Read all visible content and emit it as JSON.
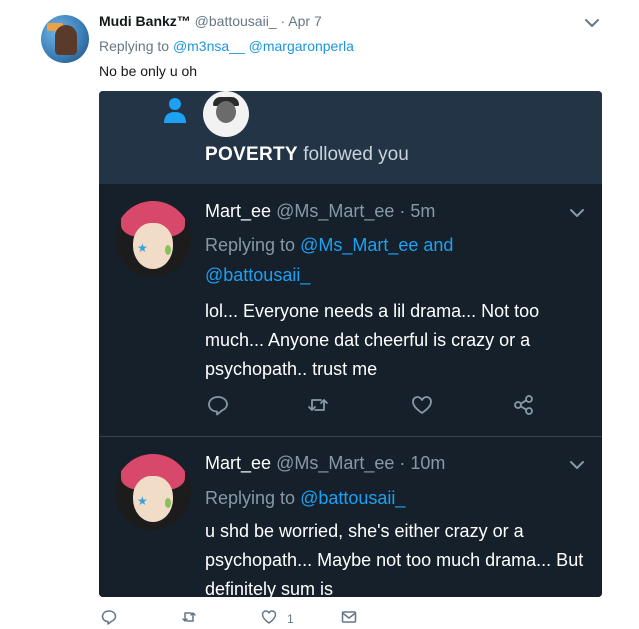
{
  "tweet": {
    "author_name": "Mudi Bankz™",
    "handle": "@battousaii_",
    "separator": " · ",
    "date": "Apr 7",
    "replying_prefix": "Replying to ",
    "replying_users": [
      "@m3nsa__",
      "@margaronperla"
    ],
    "text": "No be only u oh",
    "like_count": "1"
  },
  "embed": {
    "notification": {
      "actor": "POVERTY",
      "action": "followed you"
    },
    "replies": [
      {
        "name": "Mart_ee",
        "handle": "@Ms_Mart_ee",
        "separator": " · ",
        "time": "5m",
        "replying_prefix": "Replying to ",
        "replying_to_1": "@Ms_Mart_ee",
        "replying_and": " and",
        "replying_to_2": "@battousaii_",
        "body": "lol... Everyone needs a lil drama... Not too much... Anyone dat cheerful is crazy or a psychopath.. trust me"
      },
      {
        "name": "Mart_ee",
        "handle": "@Ms_Mart_ee",
        "separator": " · ",
        "time": "10m",
        "replying_prefix": "Replying to ",
        "replying_to_1": "@battousaii_",
        "body": "u shd be worried, she's either crazy or a psychopath... Maybe not too much drama... But definitely sum is"
      }
    ]
  },
  "colors": {
    "link": "#1b95e0",
    "embed_bg": "#15202b",
    "notif_bg": "#243447",
    "muted": "#657786"
  },
  "icons": {
    "more": "chevron-down-icon",
    "reply": "reply-icon",
    "retweet": "retweet-icon",
    "like": "heart-icon",
    "share": "share-icon",
    "message": "envelope-icon",
    "follow": "person-icon"
  }
}
